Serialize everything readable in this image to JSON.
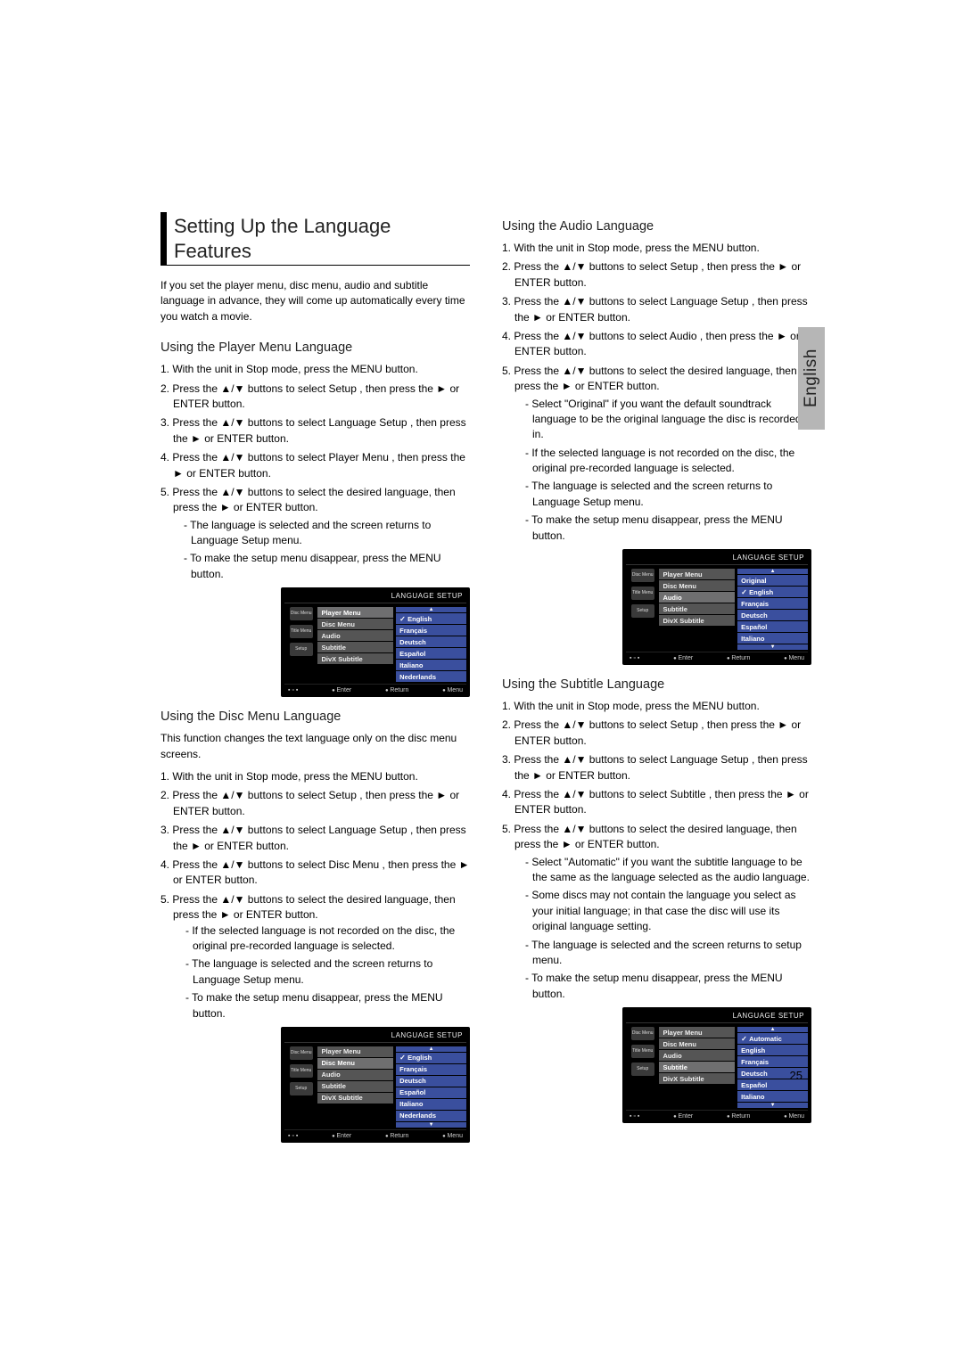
{
  "page_number": "25",
  "lang_tab": "English",
  "glyphs": {
    "up": "▲",
    "down": "▼",
    "right": "►",
    "updown": "▲/▼"
  },
  "left_col": {
    "main_title": "Setting Up the Language Features",
    "intro": "If you set the player menu, disc menu, audio and subtitle language in advance, they will come up automatically every time you watch a movie.",
    "player_menu": {
      "heading": "Using the Player Menu Language",
      "s1": "1. With the unit in Stop mode, press the MENU button.",
      "s2a": "2. Press the ",
      "s2b": " buttons to select Setup , then press the ",
      "s2c": " or ENTER button.",
      "s3a": "3. Press the ",
      "s3b": " buttons to select Language Setup , then press the ",
      "s3c": " or ENTER button.",
      "s4a": "4. Press the ",
      "s4b": " buttons to select Player Menu , then press the ",
      "s4c": " or ENTER button.",
      "s5a": "5. Press the ",
      "s5b": " buttons to select the desired language, then press the ",
      "s5c": " or ENTER button.",
      "b1": "- The language is selected and the screen returns to Language Setup menu.",
      "b2": "- To make the setup menu disappear, press the MENU button."
    },
    "disc_menu": {
      "heading": "Using the Disc Menu Language",
      "intro": "This function changes the text language only on the disc menu screens.",
      "s1": "1. With the unit in Stop mode, press the MENU button.",
      "s2a": "2. Press the ",
      "s2b": " buttons to select Setup , then press the ",
      "s2c": " or ENTER button.",
      "s3a": "3. Press the ",
      "s3b": " buttons to select Language Setup , then press the ",
      "s3c": " or ENTER button.",
      "s4a": "4. Press the  ",
      "s4b": " buttons to select Disc Menu , then press the ",
      "s4c": " or ENTER  button.",
      "s5a": "5. Press the ",
      "s5b": " buttons to select the desired language, then press the ",
      "s5c": " or ENTER button.",
      "b1": "- If the selected language is not recorded on  the disc, the original pre-recorded language is selected.",
      "b2": "- The language is selected and the screen returns to Language Setup menu.",
      "b3": "- To make the setup menu disappear, press the MENU button."
    }
  },
  "right_col": {
    "audio": {
      "heading": "Using the Audio Language",
      "s1": "1. With the unit in Stop mode, press the MENU button.",
      "s2a": "2. Press the ",
      "s2b": " buttons to select Setup , then press the ",
      "s2c": " or ENTER button.",
      "s3a": "3. Press the ",
      "s3b": " buttons to select Language Setup , then press the ",
      "s3c": " or ENTER button.",
      "s4a": "4. Press the ",
      "s4b": " buttons to select Audio , then press the ",
      "s4c": " or ENTER button.",
      "s5a": "5. Press the ",
      "s5b": " buttons to select the desired language, then press the ",
      "s5c": " or ENTER button.",
      "b1": "- Select \"Original\" if you want the default soundtrack language to be the original language the disc is recorded in.",
      "b2": "- If the selected language is not recorded on the disc, the original pre-recorded language is selected.",
      "b3": "- The language is selected and the screen returns to Language Setup menu.",
      "b4": "- To make the setup menu disappear, press the MENU button."
    },
    "subtitle": {
      "heading": "Using the Subtitle Language",
      "s1": "1. With the unit in Stop mode, press the MENU button.",
      "s2a": "2. Press the ",
      "s2b": " buttons to select Setup , then press the ",
      "s2c": " or ENTER button.",
      "s3a": "3. Press the ",
      "s3b": " buttons to select Language Setup , then press the ",
      "s3c": " or ENTER button.",
      "s4a": "4. Press the ",
      "s4b": " buttons to select Subtitle , then press the ",
      "s4c": " or ENTER button.",
      "s5a": "5. Press the ",
      "s5b": " buttons to select the desired  language, then press the ",
      "s5c": " or ENTER button.",
      "b1": "- Select \"Automatic\" if you want the subtitle  language to be the same as the language selected as the audio language.",
      "b2": "-  Some discs may not contain the language you select as your initial language; in that case the disc will use its original language setting.",
      "b3": "- The language is selected and the screen returns to setup menu.",
      "b4": "- To make the setup menu disappear, press the MENU button."
    }
  },
  "osd": {
    "title": "LANGUAGE SETUP",
    "left_icons": [
      "Disc Menu",
      "Title Menu",
      "Setup"
    ],
    "mid": [
      "Player Menu",
      "Disc Menu",
      "Audio",
      "Subtitle",
      "DivX Subtitle"
    ],
    "foot_pages": "▪ ▫ ▪",
    "foot": [
      "Enter",
      "Return",
      "Menu"
    ],
    "panel1": {
      "highlight": "Player Menu",
      "options": [
        "English",
        "Français",
        "Deutsch",
        "Español",
        "Italiano",
        "Nederlands"
      ],
      "selected": "English",
      "arrows": "top"
    },
    "panel2": {
      "highlight": "Disc Menu",
      "options": [
        "English",
        "Français",
        "Deutsch",
        "Español",
        "Italiano",
        "Nederlands"
      ],
      "selected": "English",
      "arrows": "both"
    },
    "panel3": {
      "highlight": "Audio",
      "options": [
        "Original",
        "English",
        "Français",
        "Deutsch",
        "Español",
        "Italiano"
      ],
      "selected": "English",
      "arrows": "both"
    },
    "panel4": {
      "highlight": "Subtitle",
      "options": [
        "Automatic",
        "English",
        "Français",
        "Deutsch",
        "Español",
        "Italiano"
      ],
      "selected": "Automatic",
      "arrows": "both"
    }
  }
}
